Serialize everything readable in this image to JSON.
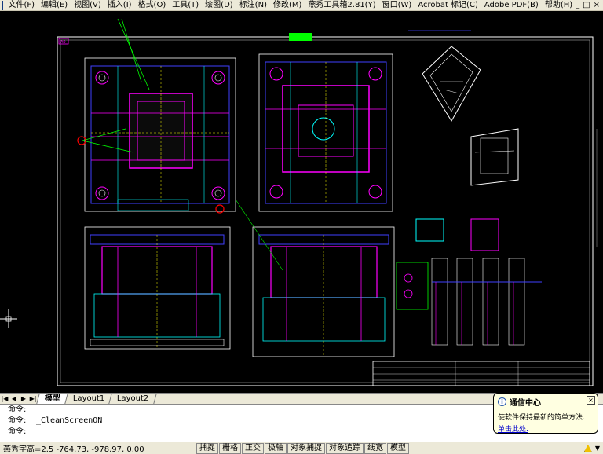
{
  "menubar": {
    "items": [
      "文件(F)",
      "编辑(E)",
      "视图(V)",
      "插入(I)",
      "格式(O)",
      "工具(T)",
      "绘图(D)",
      "标注(N)",
      "修改(M)",
      "燕秀工具箱2.81(Y)",
      "窗口(W)",
      "Acrobat 标记(C)",
      "Adobe PDF(B)",
      "帮助(H)"
    ],
    "controls": [
      "_",
      "□",
      "×"
    ]
  },
  "drawing": {
    "label_tl": "A0",
    "colors": {
      "background": "#000000",
      "frame": "#ffffff",
      "magenta": "#ff00ff",
      "cyan": "#00ffff",
      "green": "#00ff00",
      "yellow": "#ffff00",
      "blue": "#4040ff",
      "red": "#ff0000"
    }
  },
  "tabs": {
    "items": [
      {
        "label": "模型",
        "active": true
      },
      {
        "label": "Layout1",
        "active": false
      },
      {
        "label": "Layout2",
        "active": false
      }
    ]
  },
  "command": {
    "lines": [
      {
        "label": "命令:",
        "text": ""
      },
      {
        "label": "命令:",
        "text": "_CleanScreenON"
      },
      {
        "label": "命令:",
        "text": ""
      }
    ]
  },
  "status": {
    "coords": "燕秀字高=2.5  -764.73, -978.97, 0.00",
    "buttons": [
      "捕捉",
      "栅格",
      "正交",
      "极轴",
      "对象捕捉",
      "对象追踪",
      "线宽",
      "模型"
    ]
  },
  "balloon": {
    "title": "通信中心",
    "message": "使软件保持最新的简单方法.",
    "link": "单击此处."
  }
}
